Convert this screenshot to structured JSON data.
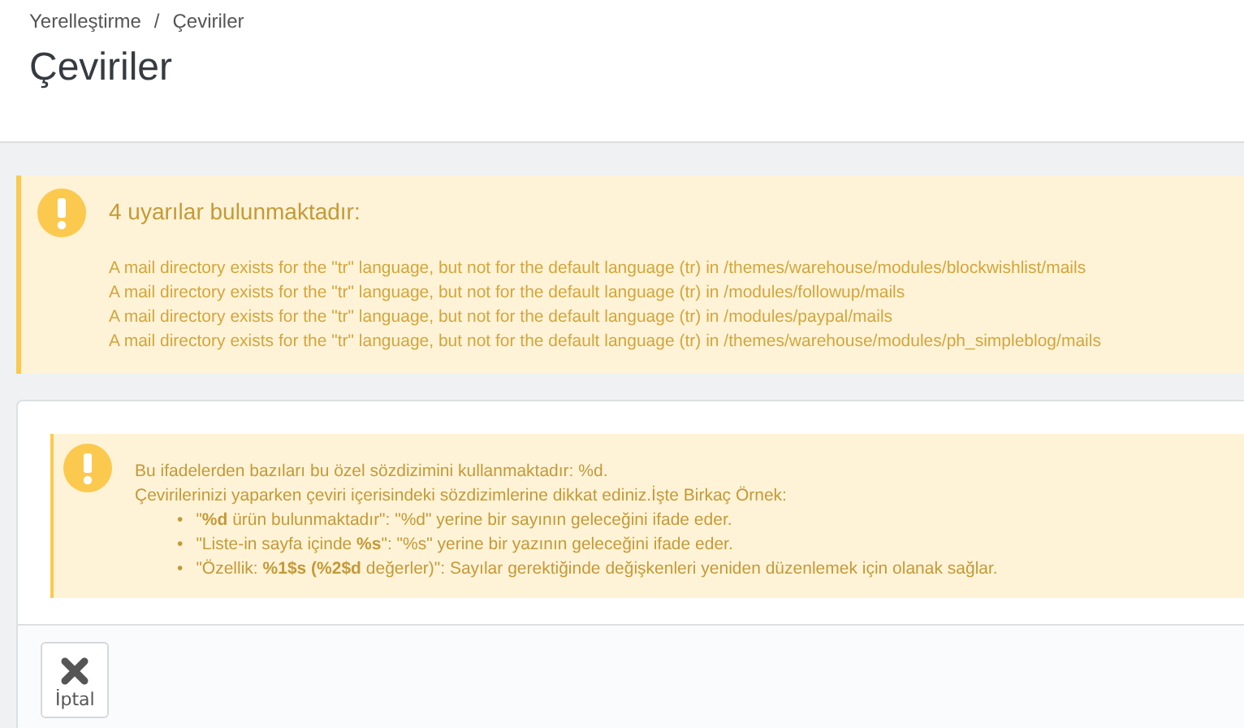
{
  "breadcrumb": [
    {
      "label": "Yerelleştirme"
    },
    {
      "label": "Çeviriler"
    }
  ],
  "breadcrumb_separator": "/",
  "title": "Çeviriler",
  "warning": {
    "heading": "4 uyarılar bulunmaktadır:",
    "lines": [
      "A mail directory exists for the \"tr\" language, but not for the default language (tr) in /themes/warehouse/modules/blockwishlist/mails",
      "A mail directory exists for the \"tr\" language, but not for the default language (tr) in /modules/followup/mails",
      "A mail directory exists for the \"tr\" language, but not for the default language (tr) in /modules/paypal/mails",
      "A mail directory exists for the \"tr\" language, but not for the default language (tr) in /themes/warehouse/modules/ph_simpleblog/mails"
    ]
  },
  "notice": {
    "lines": [
      "Bu ifadelerden bazıları bu özel sözdizimini kullanmaktadır: %d.",
      "Çevirilerinizi yaparken çeviri içerisindeki sözdizimlerine dikkat ediniz.İşte Birkaç Örnek:"
    ],
    "bullet_marker": "•",
    "bullets": [
      "\"**%d** ürün bulunmaktadır\": \"%d\" yerine bir sayının geleceğini ifade eder.",
      "\"Liste-in sayfa içinde **%s**\": \"%s\" yerine bir yazının geleceğini ifade eder.",
      "\"Özellik: **%1$s (%2$d** değerler)\": Sayılar gerektiğinde değişkenleri yeniden düzenlemek için olanak sağlar."
    ]
  },
  "footer": {
    "buttons": [
      {
        "label": "İptal",
        "kind": "cancel"
      }
    ]
  }
}
